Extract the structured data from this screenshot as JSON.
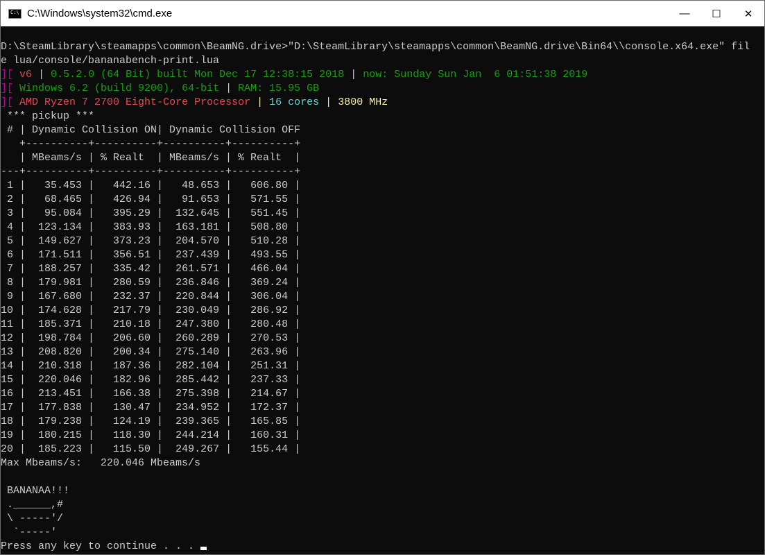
{
  "window": {
    "title": "C:\\Windows\\system32\\cmd.exe",
    "minimize": "—",
    "maximize": "☐",
    "close": "✕"
  },
  "console": {
    "command_line1": "D:\\SteamLibrary\\steamapps\\common\\BeamNG.drive>\"D:\\SteamLibrary\\steamapps\\common\\BeamNG.drive\\Bin64\\\\console.x64.exe\" fil",
    "command_line2": "e lua/console/bananabench-print.lua",
    "info1": {
      "prefix": "][",
      "version": "v6",
      "sep": "|",
      "build": "0.5.2.0 (64 Bit) built Mon Dec 17 12:38:15 2018",
      "now": "now: Sunday Sun Jan  6 01:51:38 2019"
    },
    "info2": {
      "prefix": "][",
      "os": "Windows 6.2 (build 9200), 64-bit",
      "sep": "|",
      "ram": "RAM: 15.95 GB"
    },
    "info3": {
      "prefix": "][",
      "cpu": "AMD Ryzen 7 2700 Eight-Core Processor",
      "sep": "|",
      "cores": "16 cores",
      "sep2": "|",
      "mhz": "3800 MHz"
    },
    "vehicle_heading": " *** pickup ***",
    "table_header1": " # | Dynamic Collision ON| Dynamic Collision OFF",
    "table_sep1": "   +----------+----------+----------+----------+",
    "table_header2": "   | MBeams/s | % Realt  | MBeams/s | % Realt  |",
    "table_sep2": "---+----------+----------+----------+----------+",
    "rows": [
      [
        "1",
        "35.453",
        "442.16",
        "48.653",
        "606.80"
      ],
      [
        "2",
        "68.465",
        "426.94",
        "91.653",
        "571.55"
      ],
      [
        "3",
        "95.084",
        "395.29",
        "132.645",
        "551.45"
      ],
      [
        "4",
        "123.134",
        "383.93",
        "163.181",
        "508.80"
      ],
      [
        "5",
        "149.627",
        "373.23",
        "204.570",
        "510.28"
      ],
      [
        "6",
        "171.511",
        "356.51",
        "237.439",
        "493.55"
      ],
      [
        "7",
        "188.257",
        "335.42",
        "261.571",
        "466.04"
      ],
      [
        "8",
        "179.981",
        "280.59",
        "236.846",
        "369.24"
      ],
      [
        "9",
        "167.680",
        "232.37",
        "220.844",
        "306.04"
      ],
      [
        "10",
        "174.628",
        "217.79",
        "230.049",
        "286.92"
      ],
      [
        "11",
        "185.371",
        "210.18",
        "247.380",
        "280.48"
      ],
      [
        "12",
        "198.784",
        "206.60",
        "260.289",
        "270.53"
      ],
      [
        "13",
        "208.820",
        "200.34",
        "275.140",
        "263.96"
      ],
      [
        "14",
        "210.318",
        "187.36",
        "282.104",
        "251.31"
      ],
      [
        "15",
        "220.046",
        "182.96",
        "285.442",
        "237.33"
      ],
      [
        "16",
        "213.451",
        "166.38",
        "275.398",
        "214.67"
      ],
      [
        "17",
        "177.838",
        "130.47",
        "234.952",
        "172.37"
      ],
      [
        "18",
        "179.238",
        "124.19",
        "239.365",
        "165.85"
      ],
      [
        "19",
        "180.215",
        "118.30",
        "244.214",
        "160.31"
      ],
      [
        "20",
        "185.223",
        "115.50",
        "249.267",
        "155.44"
      ]
    ],
    "max_line": "Max Mbeams/s:   220.046 Mbeams/s",
    "banana": [
      " BANANAA!!!",
      " .______,#",
      " \\ -----'/",
      "  `-----'"
    ],
    "prompt": "Press any key to continue . . . "
  },
  "colors": {
    "background": "#0c0c0c",
    "text": "#cccccc",
    "bracket": "#b4009e",
    "version": "#e74856",
    "green": "#13a10e",
    "bright_green": "#16c60c",
    "cyan": "#61d6d6",
    "yellow": "#f9f1a5"
  }
}
